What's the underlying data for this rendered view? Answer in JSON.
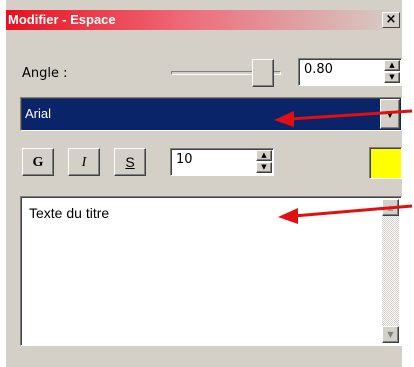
{
  "window": {
    "title": "Modifier - Espace",
    "close_glyph": "×"
  },
  "angle": {
    "label": "Angle :",
    "value": "0.80",
    "slider_level": 0.8
  },
  "font": {
    "selected": "Arial"
  },
  "style_buttons": {
    "bold": "G",
    "italic": "I",
    "underline": "S"
  },
  "font_size": {
    "value": "10"
  },
  "color": {
    "swatch": "#ffff00"
  },
  "text": {
    "value": "Texte du titre"
  },
  "colors": {
    "title_gradient_start": "#e8101e",
    "selection": "#0a246a",
    "annotation_arrow": "#e01010"
  }
}
